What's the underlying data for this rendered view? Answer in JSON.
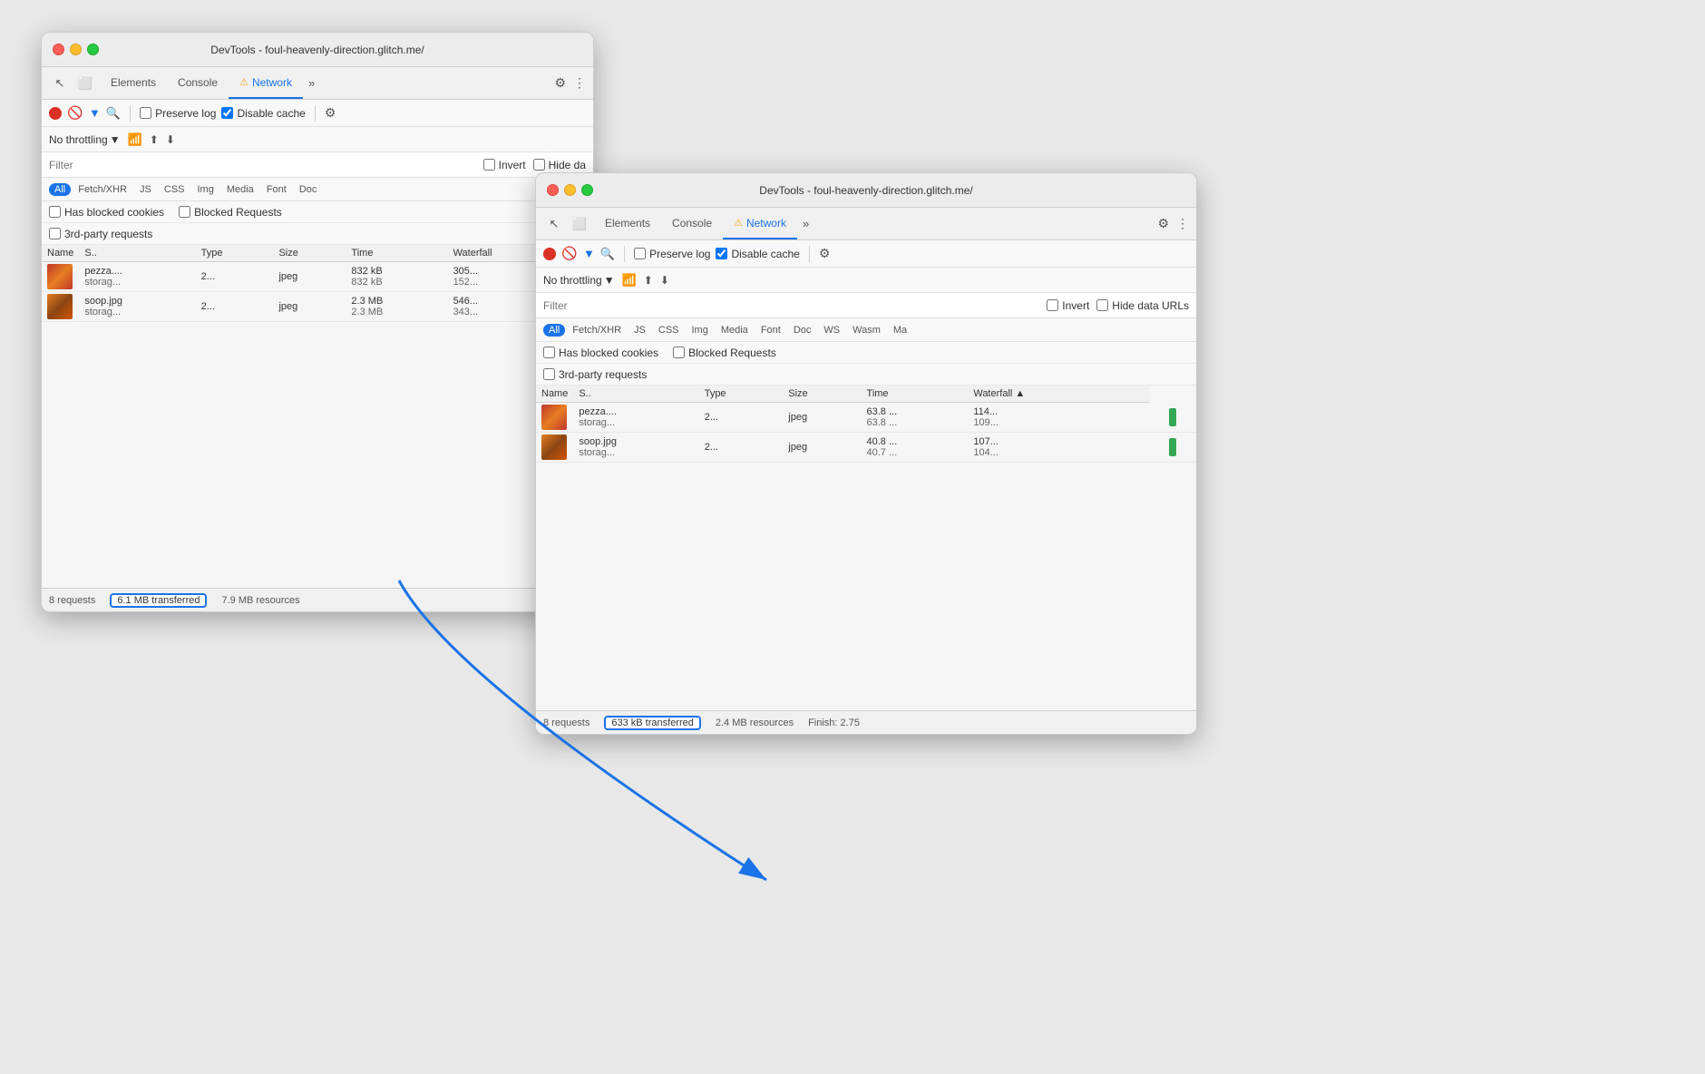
{
  "back_window": {
    "title": "DevTools - foul-heavenly-direction.glitch.me/",
    "tabs": [
      "Elements",
      "Console",
      "Network"
    ],
    "active_tab": "Network",
    "network": {
      "preserve_log": false,
      "disable_cache": true,
      "throttling": "No throttling",
      "filter_placeholder": "Filter",
      "invert": false,
      "hide_data_urls": false,
      "type_filters": [
        "All",
        "Fetch/XHR",
        "JS",
        "CSS",
        "Img",
        "Media",
        "Font",
        "Doc"
      ],
      "active_type": "All",
      "has_blocked_cookies": false,
      "blocked_requests": false,
      "third_party_requests": false,
      "columns": [
        "Name",
        "S..",
        "Type",
        "Size",
        "Time",
        "Waterfall"
      ],
      "rows": [
        {
          "thumb_type": "pizza",
          "name": "pezza....",
          "name2": "storag...",
          "status": "2...",
          "type": "jpeg",
          "size": "832 kB",
          "size2": "832 kB",
          "time": "305...",
          "time2": "152..."
        },
        {
          "thumb_type": "soop",
          "name": "soop.jpg",
          "name2": "storag...",
          "status": "2...",
          "type": "jpeg",
          "size": "2.3 MB",
          "size2": "2.3 MB",
          "time": "546...",
          "time2": "343..."
        }
      ],
      "status_bar": {
        "requests": "8 requests",
        "transferred": "6.1 MB transferred",
        "resources": "7.9 MB resources"
      }
    }
  },
  "front_window": {
    "title": "DevTools - foul-heavenly-direction.glitch.me/",
    "tabs": [
      "Elements",
      "Console",
      "Network"
    ],
    "active_tab": "Network",
    "network": {
      "preserve_log": false,
      "disable_cache": true,
      "throttling": "No throttling",
      "filter_placeholder": "Filter",
      "invert": false,
      "hide_data_urls": false,
      "type_filters": [
        "All",
        "Fetch/XHR",
        "JS",
        "CSS",
        "Img",
        "Media",
        "Font",
        "Doc",
        "WS",
        "Wasm",
        "Ma"
      ],
      "active_type": "All",
      "has_blocked_cookies": false,
      "blocked_requests": false,
      "third_party_requests": false,
      "columns": [
        "Name",
        "S..",
        "Type",
        "Size",
        "Time",
        "Waterfall"
      ],
      "rows": [
        {
          "thumb_type": "pizza",
          "name": "pezza....",
          "name2": "storag...",
          "status": "2...",
          "type": "jpeg",
          "size": "63.8 ...",
          "size2": "63.8 ...",
          "time": "114...",
          "time2": "109...",
          "has_waterfall": true,
          "waterfall_color": "green"
        },
        {
          "thumb_type": "soop",
          "name": "soop.jpg",
          "name2": "storag...",
          "status": "2...",
          "type": "jpeg",
          "size": "40.8 ...",
          "size2": "40.7 ...",
          "time": "107...",
          "time2": "104...",
          "has_waterfall": true,
          "waterfall_color": "green"
        }
      ],
      "status_bar": {
        "requests": "8 requests",
        "transferred": "633 kB transferred",
        "resources": "2.4 MB resources",
        "finish": "Finish: 2.75"
      }
    }
  },
  "labels": {
    "elements": "Elements",
    "console": "Console",
    "network": "Network",
    "preserve_log": "Preserve log",
    "disable_cache": "Disable cache",
    "no_throttling": "No throttling",
    "filter": "Filter",
    "invert": "Invert",
    "hide_data_urls": "Hide data URLs",
    "has_blocked_cookies": "Has blocked cookies",
    "blocked_requests": "Blocked Requests",
    "third_party_requests": "3rd-party requests",
    "all": "All",
    "fetch_xhr": "Fetch/XHR",
    "js": "JS",
    "css": "CSS",
    "img": "Img",
    "media": "Media",
    "font": "Font",
    "doc": "Doc",
    "ws": "WS",
    "wasm": "Wasm",
    "ma": "Ma",
    "name": "Name",
    "s": "S..",
    "type": "Type",
    "size": "Size",
    "time": "Time",
    "waterfall": "Waterfall"
  }
}
